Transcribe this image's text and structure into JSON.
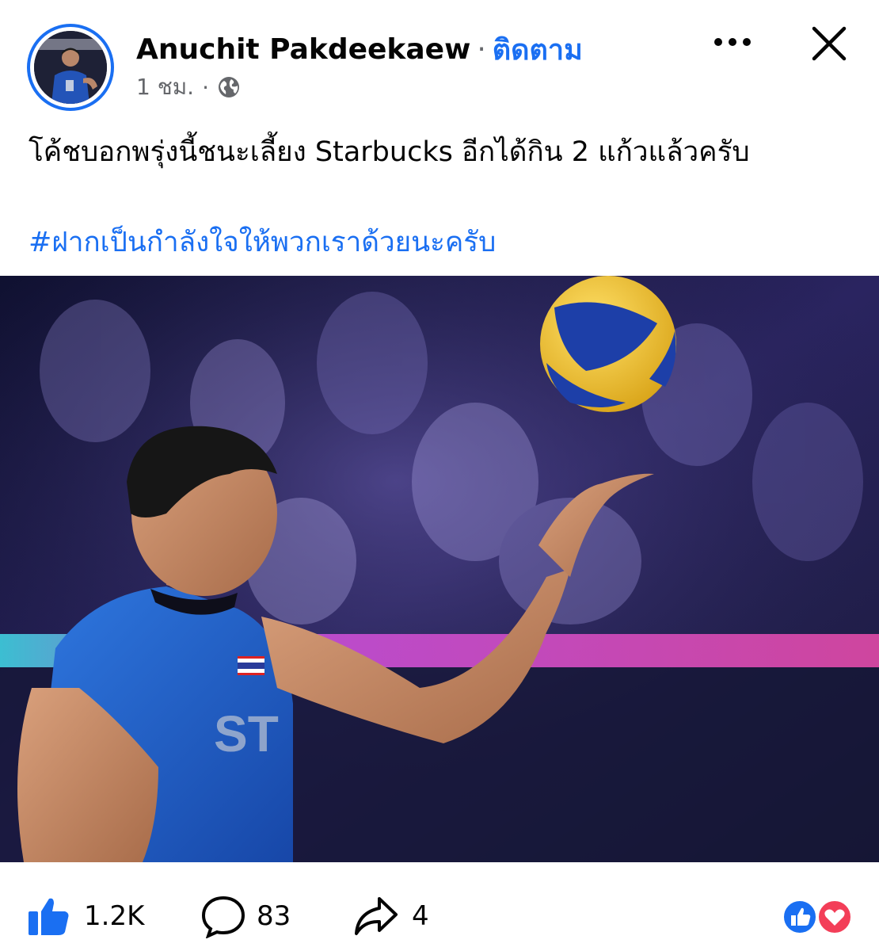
{
  "header": {
    "author_name": "Anuchit Pakdeekaew",
    "separator": "·",
    "follow_label": "ติดตาม",
    "time_label": "1 ชม.",
    "meta_separator": "·",
    "privacy_icon": "globe-icon",
    "more_icon": "more-horizontal-icon",
    "close_icon": "close-icon"
  },
  "post": {
    "text": "โค้ชบอกพรุ่งนี้ชนะเลี้ยง Starbucks อีกได้กิน 2 แก้วแล้วครับ",
    "hashtag": "#ฝากเป็นกำลังใจให้พวกเราด้วยนะครับ"
  },
  "footer": {
    "like_count": "1.2K",
    "comment_count": "83",
    "share_count": "4",
    "like_icon": "thumbs-up-icon",
    "comment_icon": "comment-bubble-icon",
    "share_icon": "share-arrow-icon",
    "reaction_icons": [
      "like-reaction-icon",
      "love-reaction-icon"
    ]
  },
  "colors": {
    "accent_blue": "#1a6ff2",
    "meta_gray": "#65676b",
    "love_red": "#f33e58",
    "jersey_blue": "#1f5fc8",
    "ball_yellow": "#f2c530",
    "ball_blue": "#1d3fa8"
  }
}
